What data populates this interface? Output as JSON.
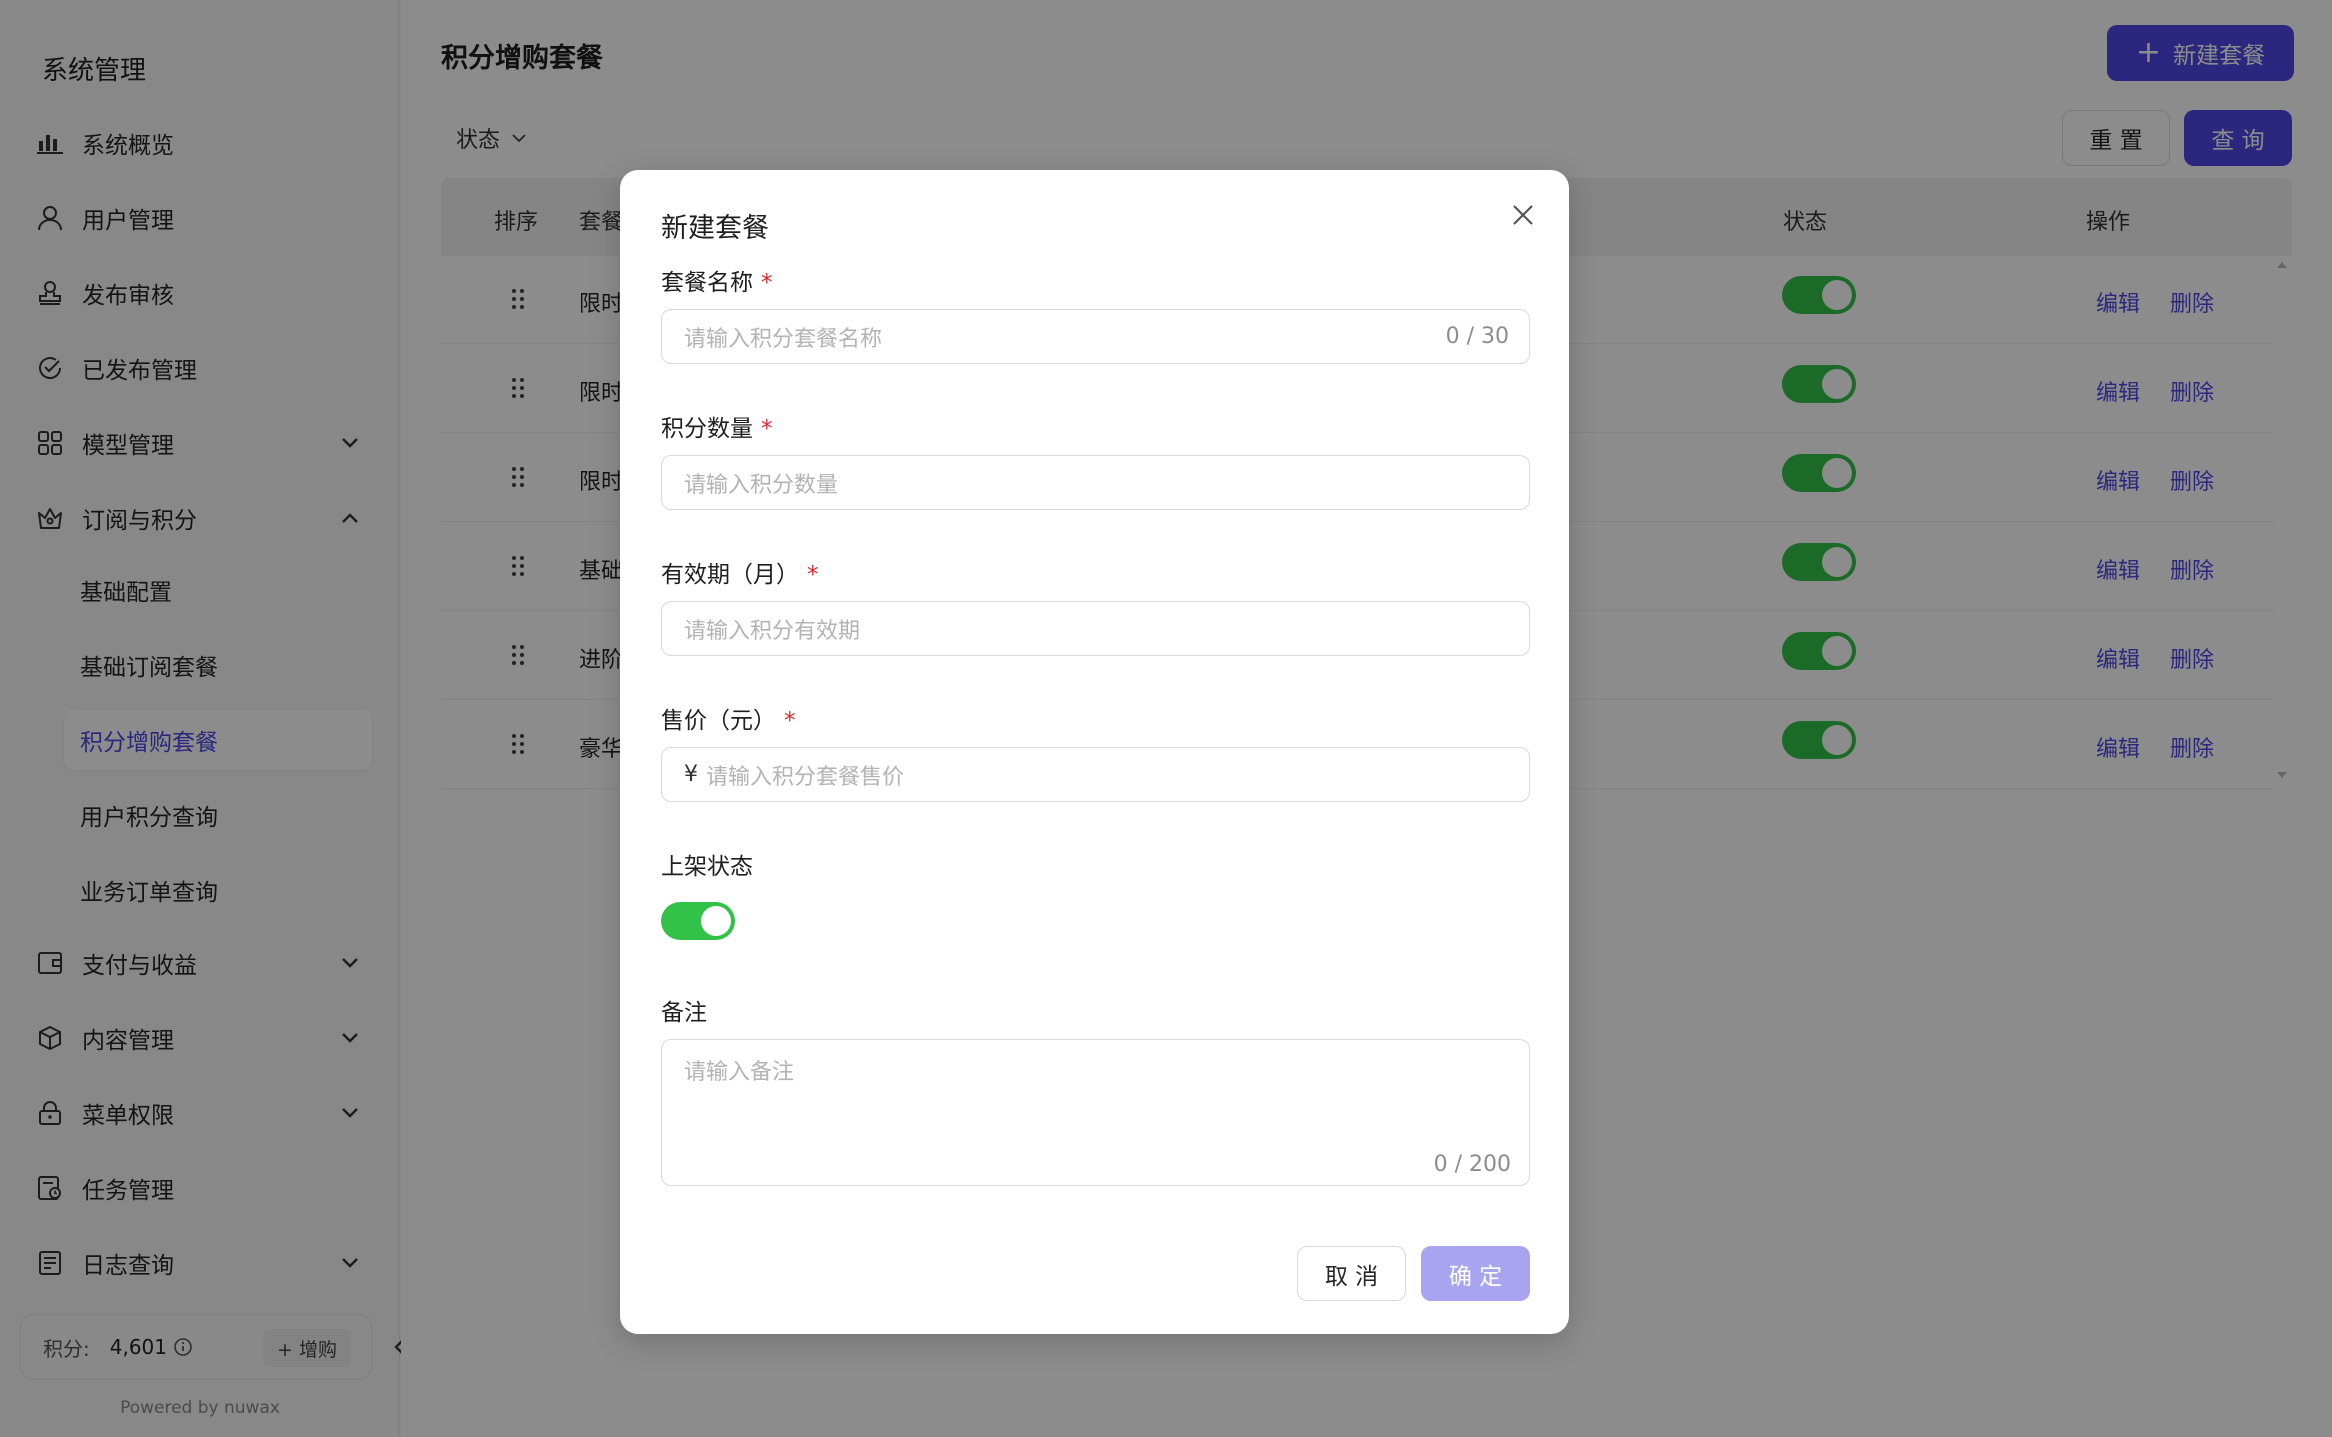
{
  "sidebar": {
    "title": "系统管理",
    "items": [
      {
        "label": "系统概览",
        "icon": "bar-chart-icon"
      },
      {
        "label": "用户管理",
        "icon": "user-icon"
      },
      {
        "label": "发布审核",
        "icon": "stamp-icon"
      },
      {
        "label": "已发布管理",
        "icon": "check-circle-icon"
      },
      {
        "label": "模型管理",
        "icon": "grid-icon"
      },
      {
        "label": "订阅与积分",
        "icon": "crown-icon"
      },
      {
        "label": "支付与收益",
        "icon": "wallet-icon"
      },
      {
        "label": "内容管理",
        "icon": "box-icon"
      },
      {
        "label": "菜单权限",
        "icon": "lock-icon"
      },
      {
        "label": "任务管理",
        "icon": "task-icon"
      },
      {
        "label": "日志查询",
        "icon": "log-icon"
      }
    ],
    "subitems": [
      {
        "label": "基础配置"
      },
      {
        "label": "基础订阅套餐"
      },
      {
        "label": "积分增购套餐"
      },
      {
        "label": "用户积分查询"
      },
      {
        "label": "业务订单查询"
      }
    ],
    "credit_label": "积分:",
    "credit_value": "4,601",
    "buy_label": "+ 增购",
    "powered": "Powered by nuwax"
  },
  "main": {
    "title": "积分增购套餐",
    "new_button": "新建套餐",
    "filter_status": "状态",
    "reset": "重 置",
    "query": "查 询",
    "columns": {
      "sort": "排序",
      "name": "套餐",
      "status": "状态",
      "action": "操作"
    },
    "rows": [
      {
        "name": "限时"
      },
      {
        "name": "限时"
      },
      {
        "name": "限时"
      },
      {
        "name": "基础"
      },
      {
        "name": "进阶"
      },
      {
        "name": "豪华"
      }
    ],
    "edit": "编辑",
    "delete": "删除"
  },
  "modal": {
    "title": "新建套餐",
    "name_label": "套餐名称",
    "name_placeholder": "请输入积分套餐名称",
    "name_count": "0 / 30",
    "points_label": "积分数量",
    "points_placeholder": "请输入积分数量",
    "validity_label": "有效期（月）",
    "validity_placeholder": "请输入积分有效期",
    "price_label": "售价（元）",
    "price_prefix": "¥",
    "price_placeholder": "请输入积分套餐售价",
    "shelf_label": "上架状态",
    "shelf_on": true,
    "remark_label": "备注",
    "remark_placeholder": "请输入备注",
    "remark_count": "0 / 200",
    "required_mark": "*",
    "cancel": "取 消",
    "ok": "确 定"
  },
  "colors": {
    "accent": "#5147e5",
    "switch_on": "#32c247",
    "required": "#e0282e"
  }
}
